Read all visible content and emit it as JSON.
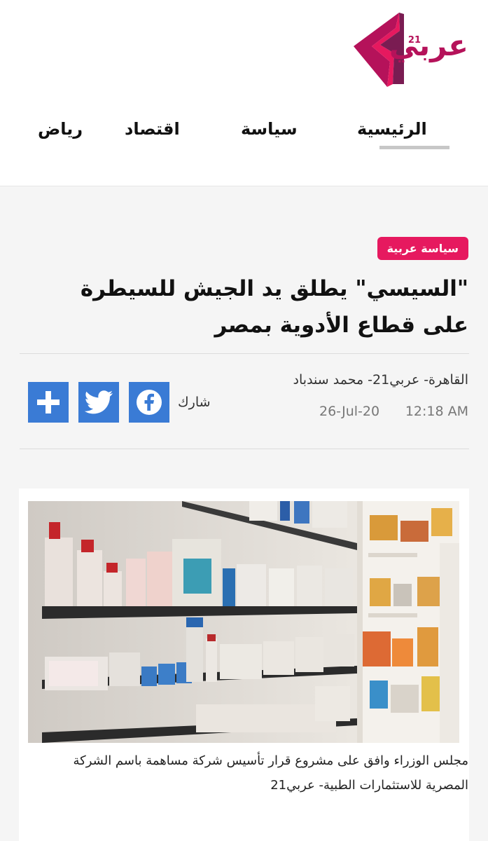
{
  "brand": {
    "logo_text": "عربي",
    "logo_sup": "21"
  },
  "nav": {
    "items": [
      {
        "label": "الرئيسية",
        "active": true
      },
      {
        "label": "سياسة"
      },
      {
        "label": "اقتصاد"
      },
      {
        "label": "رياض"
      }
    ]
  },
  "article": {
    "category": "سياسة عربية",
    "title": "\"السيسي\" يطلق يد الجيش للسيطرة على قطاع الأدوية بمصر",
    "byline": "القاهرة- عربي21- محمد سندباد",
    "time": "12:18 AM",
    "date": "26-Jul-20",
    "share_label": "شارك",
    "share_buttons": [
      {
        "icon": "facebook-icon"
      },
      {
        "icon": "twitter-icon"
      },
      {
        "icon": "plus-icon"
      }
    ],
    "image_caption": "مجلس الوزراء وافق على مشروع قرار تأسيس شركة مساهمة باسم الشركة المصرية للاستثمارات الطبية- عربي21"
  },
  "colors": {
    "brand_magenta": "#b5125a",
    "badge_pink": "#e6195f",
    "share_blue": "#3a7bd5"
  }
}
